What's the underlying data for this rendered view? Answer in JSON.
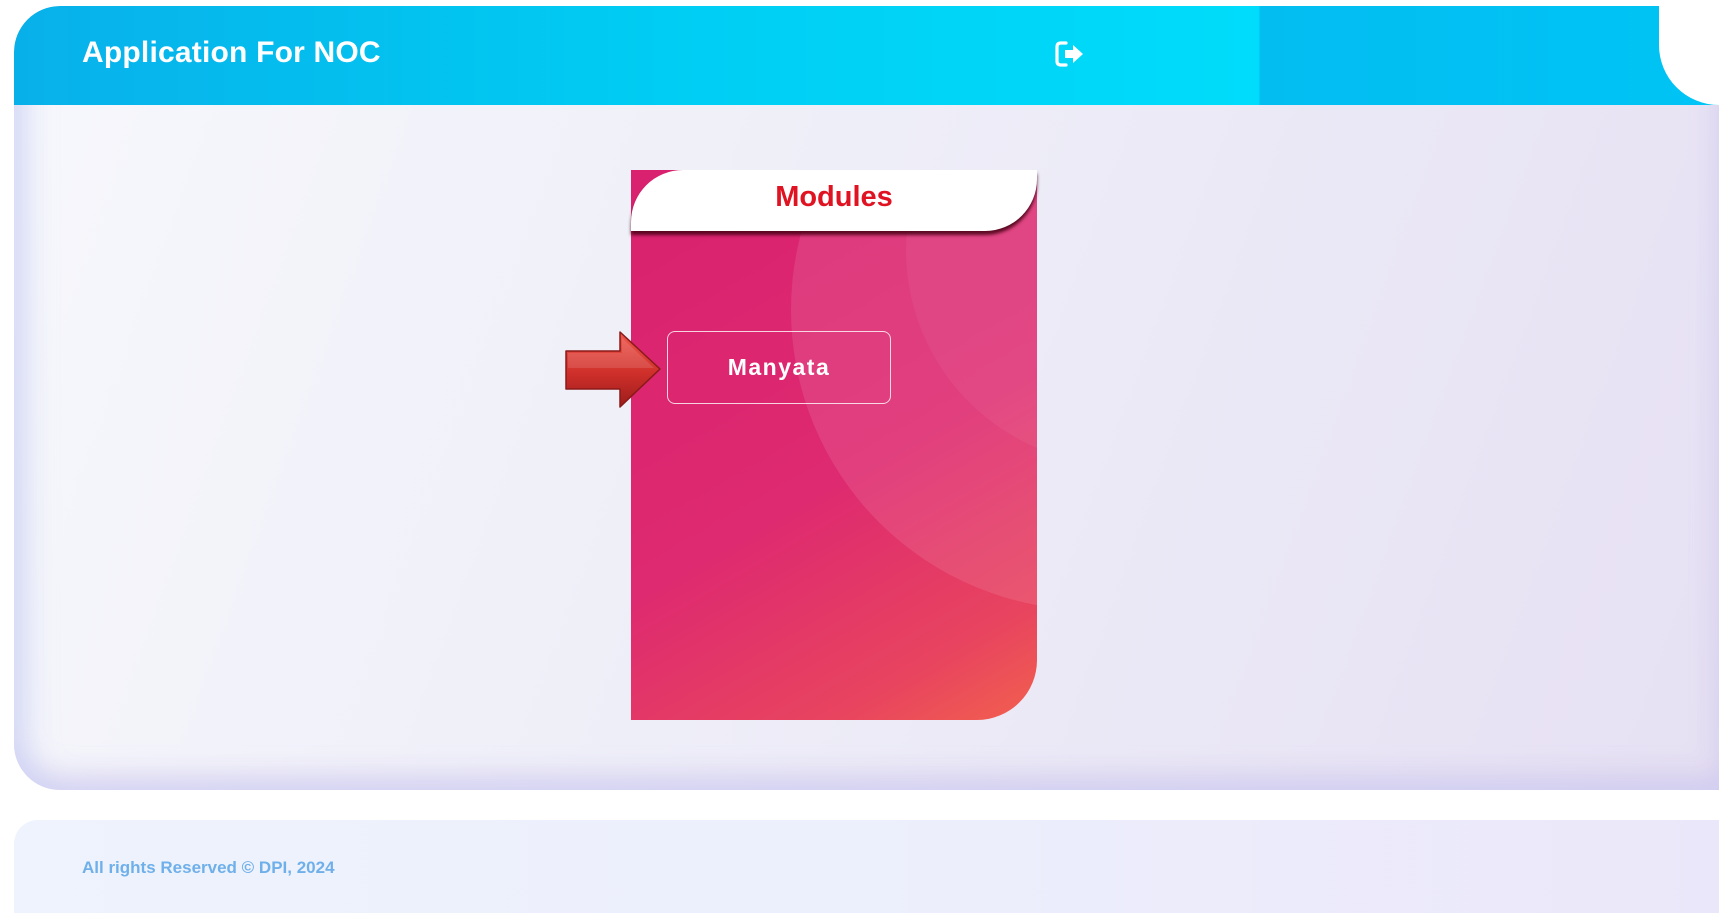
{
  "header": {
    "title": "Application For NOC",
    "logout_icon": "logout-icon"
  },
  "modules_card": {
    "title": "Modules",
    "items": [
      {
        "label": "Manyata"
      }
    ],
    "pointer_icon": "red-arrow-icon"
  },
  "footer": {
    "text": "All rights Reserved © DPI, 2024"
  },
  "colors": {
    "header_accent": "#00cdf3",
    "card_primary": "#d9216f",
    "card_secondary": "#f2604e",
    "modules_title": "#e01322",
    "footer_text": "#6fb0ea"
  }
}
